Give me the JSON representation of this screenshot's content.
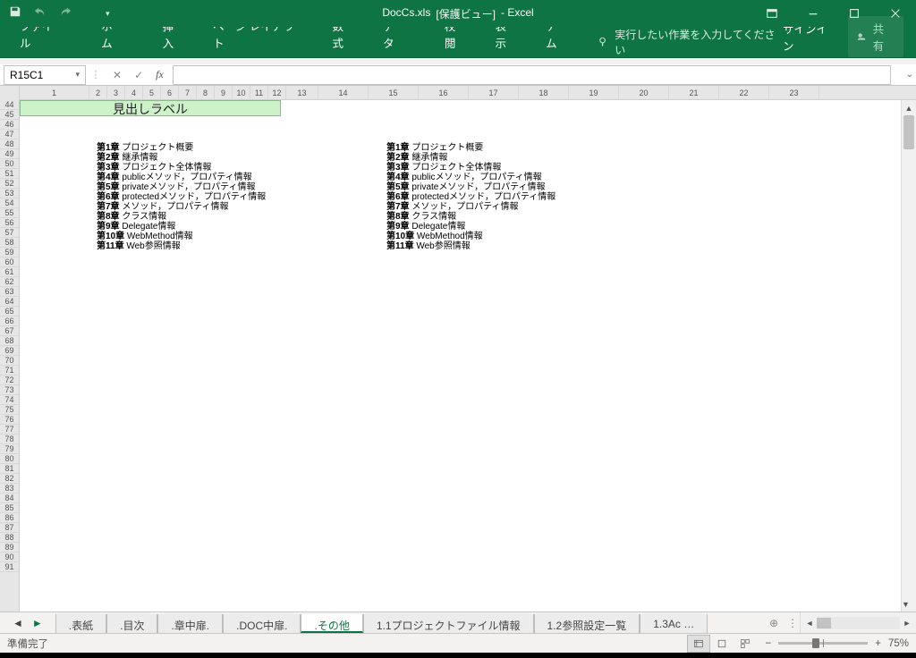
{
  "title": {
    "file": "DocCs.xls",
    "mode": "[保護ビュー]",
    "app": "- Excel"
  },
  "ribbon": {
    "tabs": [
      "ファイル",
      "ホーム",
      "挿入",
      "ページ レイアウト",
      "数式",
      "データ",
      "校閲",
      "表示",
      "チーム"
    ],
    "tell_placeholder": "実行したい作業を入力してください",
    "signin": "サインイン",
    "share": "共有"
  },
  "fx": {
    "namebox": "R15C1"
  },
  "colheaders": [
    "1",
    "2",
    "3",
    "4",
    "5",
    "6",
    "7",
    "8",
    "9",
    "10",
    "11",
    "12",
    "13",
    "14",
    "15",
    "16",
    "17",
    "18",
    "19",
    "20",
    "21",
    "22",
    "23"
  ],
  "rowstart": 44,
  "rowend": 91,
  "headlabel": "見出しラベル",
  "toc": [
    "第1章 プロジェクト概要",
    "第2章 継承情報",
    "第3章 プロジェクト全体情報",
    "第4章 publicメソッド，プロパティ情報",
    "第5章 privateメソッド，プロパティ情報",
    "第6章 protectedメソッド，プロパティ情報",
    "第7章 メソッド，プロパティ情報",
    "第8章 クラス情報",
    "第9章 Delegate情報",
    "第10章 WebMethod情報",
    "第11章 Web参照情報"
  ],
  "sheets": [
    ".表紙",
    ".目次",
    ".章中扉.",
    ".DOC中扉.",
    ".その他",
    "1.1プロジェクトファイル情報",
    "1.2参照設定一覧",
    "1.3Ac …"
  ],
  "active_sheet": 4,
  "status": {
    "ready": "準備完了",
    "zoom": "75%"
  }
}
